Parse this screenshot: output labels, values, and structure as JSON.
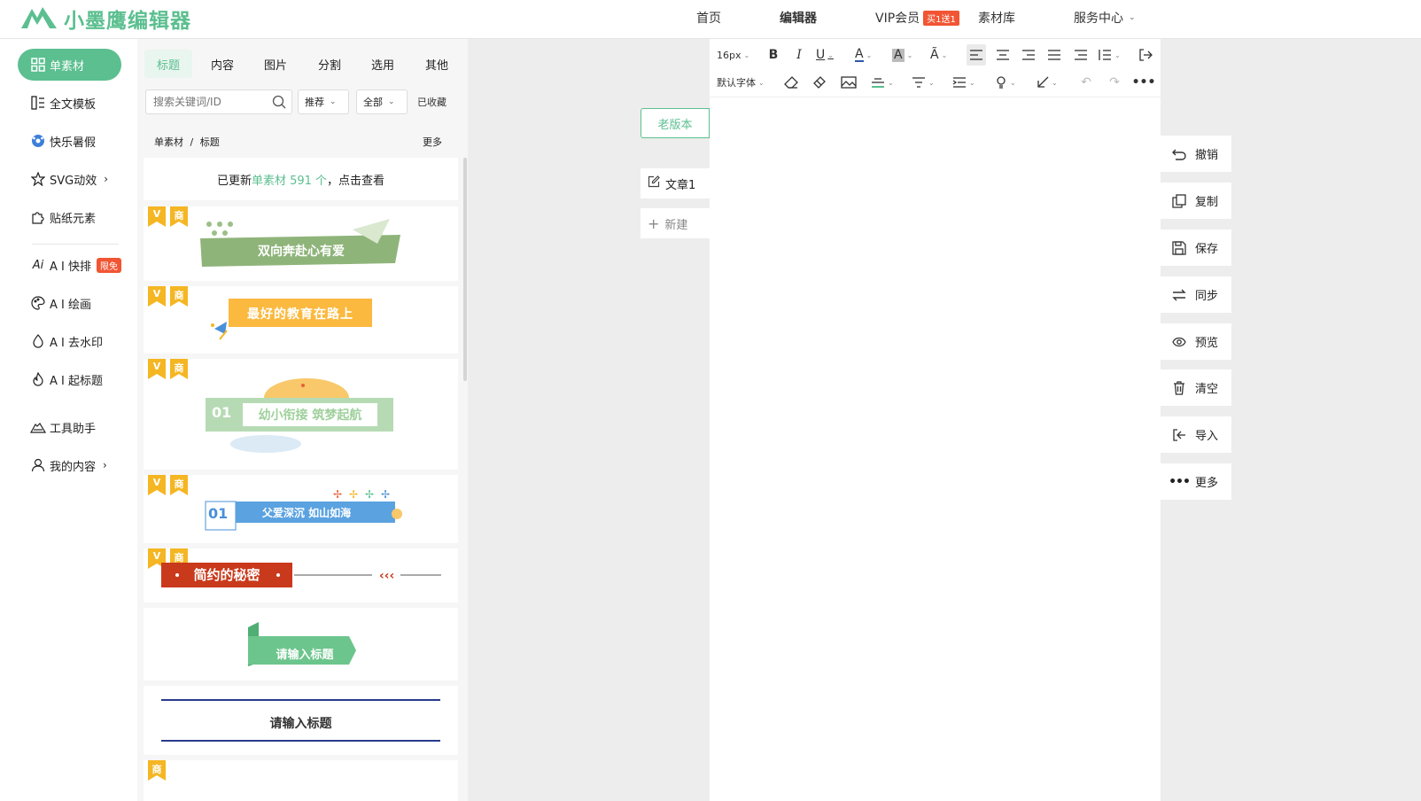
{
  "app": {
    "logo_text": "小墨鹰编辑器",
    "brand_color": "#5bbf8f",
    "accent_red": "#f15533"
  },
  "topnav": {
    "home": "首页",
    "editor": "编辑器",
    "vip": "VIP会员",
    "vip_badge": "买1送1",
    "library": "素材库",
    "service": "服务中心"
  },
  "leftnav": {
    "items": [
      {
        "label": "单素材",
        "icon": "grid-icon",
        "active": true
      },
      {
        "label": "全文模板",
        "icon": "template-icon"
      },
      {
        "label": "快乐暑假",
        "icon": "ball-icon"
      },
      {
        "label": "SVG动效",
        "icon": "star-icon",
        "arrow": "›"
      },
      {
        "label": "贴纸元素",
        "icon": "puzzle-icon"
      },
      {
        "label": "A I 快排",
        "icon": "ai-icon",
        "badge": "限免"
      },
      {
        "label": "A I 绘画",
        "icon": "palette-icon"
      },
      {
        "label": "A I 去水印",
        "icon": "drop-icon"
      },
      {
        "label": "A I 起标题",
        "icon": "fire-icon"
      },
      {
        "label": "工具助手",
        "icon": "tool-icon"
      },
      {
        "label": "我的内容",
        "icon": "user-icon",
        "arrow": "›"
      }
    ]
  },
  "panel": {
    "tabs": [
      "标题",
      "内容",
      "图片",
      "分割",
      "选用",
      "其他"
    ],
    "active_tab": "标题",
    "search_placeholder": "搜索关键词/ID",
    "sort_filter": "推荐",
    "range_filter": "全部",
    "favorites": "已收藏",
    "breadcrumb_root": "单素材",
    "breadcrumb_sep": "/",
    "breadcrumb_current": "标题",
    "more": "更多",
    "update_prefix": "已更新",
    "update_highlight": "单素材 591 个",
    "update_suffix": "，点击查看",
    "flag_v": "V",
    "flag_commercial": "商",
    "items": [
      {
        "text": "双向奔赴心有爱"
      },
      {
        "text": "最好的教育在路上"
      },
      {
        "number": "01",
        "text": "幼小衔接 筑梦起航"
      },
      {
        "number": "01",
        "text": "父爱深沉 如山如海"
      },
      {
        "text": "简约的秘密"
      },
      {
        "text": "请输入标题"
      },
      {
        "text": "请输入标题"
      }
    ]
  },
  "editor": {
    "old_version": "老版本",
    "article_tab": "文章1",
    "new_tab": "新建",
    "font_size": "16px",
    "font_family": "默认字体"
  },
  "actions": [
    {
      "label": "撤销",
      "icon": "undo-icon"
    },
    {
      "label": "复制",
      "icon": "copy-icon"
    },
    {
      "label": "保存",
      "icon": "save-icon"
    },
    {
      "label": "同步",
      "icon": "sync-icon"
    },
    {
      "label": "预览",
      "icon": "eye-icon"
    },
    {
      "label": "清空",
      "icon": "trash-icon"
    },
    {
      "label": "导入",
      "icon": "import-icon"
    },
    {
      "label": "更多",
      "icon": "more-icon"
    }
  ]
}
